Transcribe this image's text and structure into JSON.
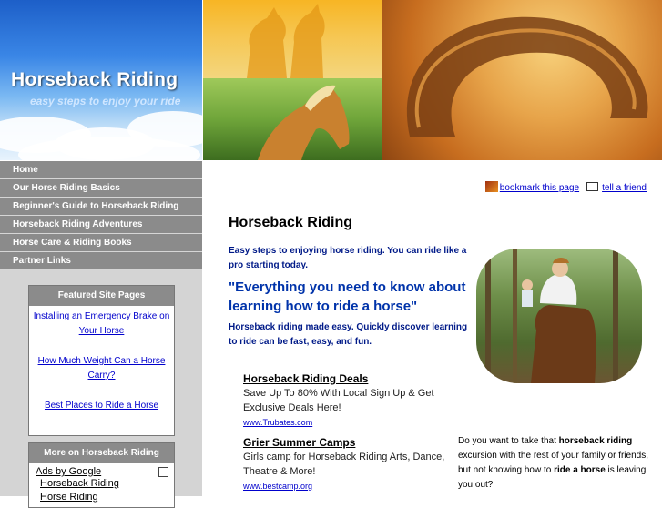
{
  "header": {
    "title": "Horseback Riding",
    "subtitle": "easy steps to enjoy your ride"
  },
  "nav": {
    "items": [
      {
        "label": "Home"
      },
      {
        "label": "Our Horse Riding Basics"
      },
      {
        "label": "Beginner's Guide to Horseback Riding"
      },
      {
        "label": "Horseback Riding Adventures"
      },
      {
        "label": "Horse Care & Riding Books"
      },
      {
        "label": "Partner Links"
      }
    ]
  },
  "featured": {
    "heading": "Featured Site Pages",
    "links": [
      {
        "label": "Installing an Emergency Brake on Your Horse"
      },
      {
        "label": "How Much Weight Can a Horse Carry?"
      },
      {
        "label": "Best Places to Ride a Horse"
      }
    ]
  },
  "more": {
    "heading": "More on Horseback Riding",
    "ads_label": "Ads by Google",
    "ads_links": [
      {
        "label": "Horseback Riding"
      },
      {
        "label": "Horse Riding"
      }
    ]
  },
  "toplinks": {
    "bookmark": "bookmark this page",
    "tell_friend": "tell a friend"
  },
  "main": {
    "title": "Horseback Riding",
    "intro": "Easy steps to enjoying horse riding. You can ride like a pro starting today.",
    "quote": "\"Everything you need to know about learning how to ride a horse\"",
    "made_easy": "Horseback riding made easy. Quickly discover learning to ride can be fast, easy, and fun."
  },
  "ads": [
    {
      "title": "Horseback Riding Deals",
      "text": "Save Up To 80% With Local Sign Up & Get Exclusive Deals Here!",
      "url": "www.Trubates.com"
    },
    {
      "title": "Grier Summer Camps",
      "text": "Girls camp for Horseback Riding Arts, Dance, Theatre & More!",
      "url": "www.bestcamp.org"
    }
  ],
  "right_para": {
    "part1": "Do you want to take that ",
    "bold1": "horseback riding",
    "part2": " excursion with the rest of your family or friends, but not knowing how to ",
    "bold2": "ride a horse",
    "part3": " is leaving you out?"
  },
  "colors": {
    "nav_bg": "#8b8b8b",
    "left_panel_bg": "#d4d4d4",
    "heading_blue": "#001a88",
    "link_blue": "#0000cc"
  }
}
